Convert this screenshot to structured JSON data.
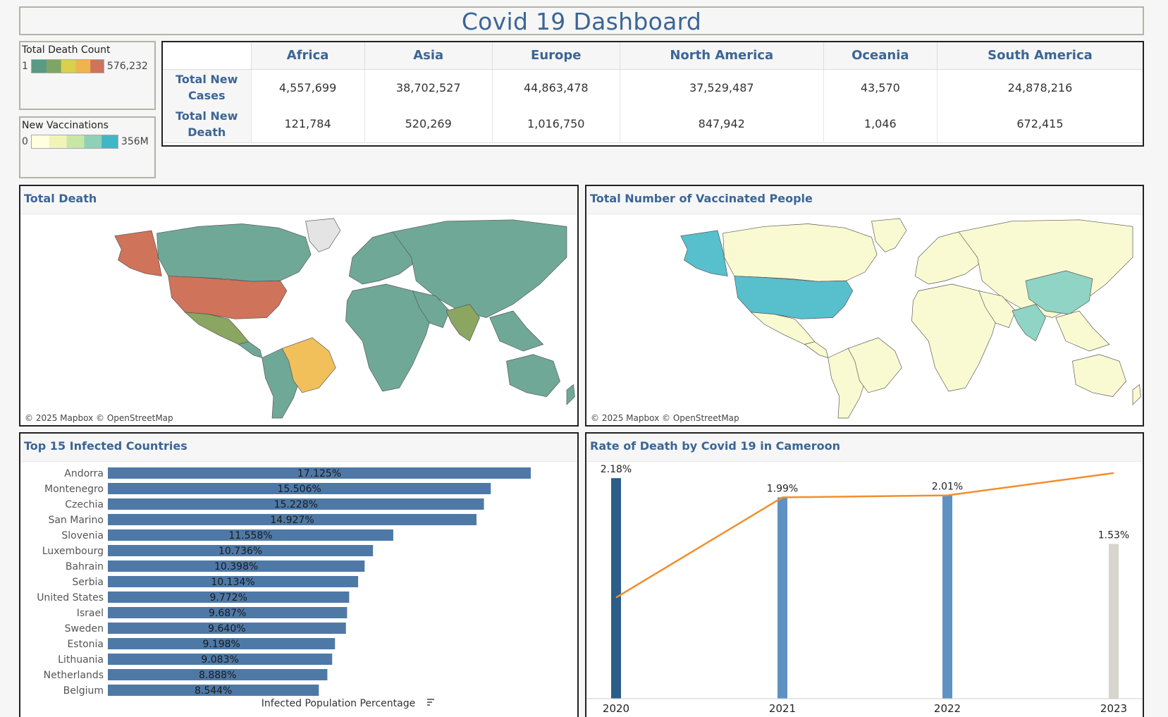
{
  "dashboard": {
    "title": "Covid 19 Dashboard"
  },
  "legend_death": {
    "title": "Total Death Count",
    "min": "1",
    "max": "576,232",
    "colors": [
      "#5a9a82",
      "#7ea566",
      "#d9d04e",
      "#f0b44e",
      "#cf735a"
    ]
  },
  "legend_vacc": {
    "title": "New Vaccinations",
    "min": "0",
    "max": "356M",
    "colors": [
      "#ffffe0",
      "#f0f4b6",
      "#c8e6a5",
      "#8fd0b8",
      "#40b6c6"
    ]
  },
  "kpi": {
    "columns": [
      "Africa",
      "Asia",
      "Europe",
      "North America",
      "Oceania",
      "South America"
    ],
    "rows": [
      {
        "label": "Total New Cases",
        "values": [
          "4,557,699",
          "38,702,527",
          "44,863,478",
          "37,529,487",
          "43,570",
          "24,878,216"
        ]
      },
      {
        "label": "Total New Death",
        "values": [
          "121,784",
          "520,269",
          "1,016,750",
          "847,942",
          "1,046",
          "672,415"
        ]
      }
    ]
  },
  "map_death": {
    "title": "Total Death",
    "attribution": "© 2025 Mapbox © OpenStreetMap",
    "colors": {
      "default": "#6fa897",
      "high": "#cf735a",
      "mid": "#f2c05a",
      "low": "#8aa660",
      "ocean": "#ffffff",
      "greenland": "#e4e4e4"
    }
  },
  "map_vacc": {
    "title": "Total Number of Vaccinated People",
    "attribution": "© 2025 Mapbox © OpenStreetMap",
    "colors": {
      "default": "#fafad2",
      "high": "#58bfcc",
      "mid": "#8fd4c4",
      "ocean": "#ffffff"
    }
  },
  "chart_data": [
    {
      "type": "bar",
      "title": "Top 15 Infected Countries",
      "xlabel": "Infected Population Percentage",
      "categories": [
        "Andorra",
        "Montenegro",
        "Czechia",
        "San Marino",
        "Slovenia",
        "Luxembourg",
        "Bahrain",
        "Serbia",
        "United States",
        "Israel",
        "Sweden",
        "Estonia",
        "Lithuania",
        "Netherlands",
        "Belgium"
      ],
      "values": [
        17.125,
        15.506,
        15.228,
        14.927,
        11.558,
        10.736,
        10.398,
        10.134,
        9.772,
        9.687,
        9.64,
        9.198,
        9.083,
        8.888,
        8.544
      ],
      "labels": [
        "17.125%",
        "15.506%",
        "15.228%",
        "14.927%",
        "11.558%",
        "10.736%",
        "10.398%",
        "10.134%",
        "9.772%",
        "9.687%",
        "9.640%",
        "9.198%",
        "9.083%",
        "8.888%",
        "8.544%"
      ],
      "color": "#4e79a7",
      "grid": false
    },
    {
      "type": "bar",
      "title": "Rate of Death by Covid 19 in Cameroon",
      "categories": [
        "2020",
        "2021",
        "2022",
        "2023"
      ],
      "values": [
        2.18,
        1.99,
        2.01,
        1.53
      ],
      "labels": [
        "2.18%",
        "1.99%",
        "2.01%",
        "1.53%"
      ],
      "bar_colors": [
        "#2b5c8a",
        "#5f92c2",
        "#5f92c2",
        "#d8d5cc"
      ],
      "line_series": {
        "values": [
          1.0,
          1.99,
          2.01,
          2.23
        ],
        "color": "#f28e2b"
      },
      "ylim": [
        0,
        2.3
      ],
      "grid": false
    }
  ]
}
